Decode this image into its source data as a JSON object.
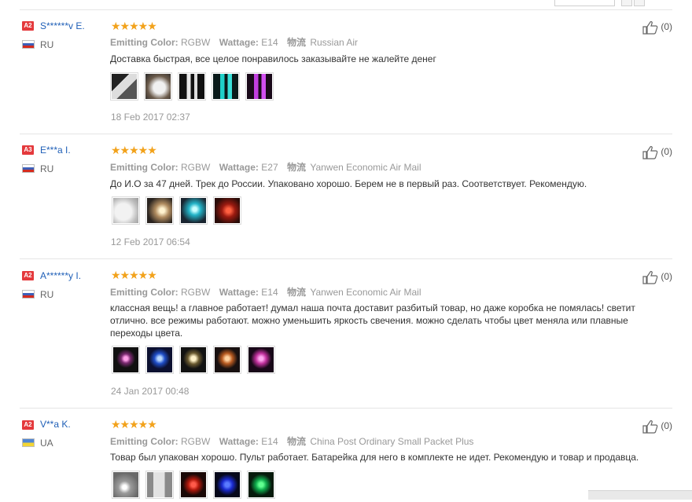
{
  "labels": {
    "color": "Emitting Color:",
    "wattage": "Wattage:",
    "shipping": "物流"
  },
  "stars": "★★★★★",
  "reviews": [
    {
      "badge": "A2",
      "name": "S******v E.",
      "country": "RU",
      "color": "RGBW",
      "wattage": "E14",
      "shipping": "Russian Air",
      "text": "Доставка быстрая, все целое понравилось заказывайте не жалейте денег",
      "date": "18 Feb 2017 02:37",
      "likes": "(0)"
    },
    {
      "badge": "A3",
      "name": "E***a I.",
      "country": "RU",
      "color": "RGBW",
      "wattage": "E27",
      "shipping": "Yanwen Economic Air Mail",
      "text": "До И.О за 47 дней. Трек до России. Упаковано хорошо. Берем не в первый раз. Соответствует. Рекомендую.",
      "date": "12 Feb 2017 06:54",
      "likes": "(0)"
    },
    {
      "badge": "A2",
      "name": "A******y I.",
      "country": "RU",
      "color": "RGBW",
      "wattage": "E14",
      "shipping": "Yanwen Economic Air Mail",
      "text": "классная вещь! а главное работает! думал наша почта доставит разбитый товар, но даже коробка не помялась! светит отлично. все режимы работают. можно уменьшить яркость свечения. можно сделать чтобы цвет меняла или плавные переходы цвета.",
      "date": "24 Jan 2017 00:48",
      "likes": "(0)"
    },
    {
      "badge": "A2",
      "name": "V**a K.",
      "country": "UA",
      "color": "RGBW",
      "wattage": "E14",
      "shipping": "China Post Ordinary Small Packet Plus",
      "text": "Товар был упакован хорошо. Пульт работает. Батарейка для него в комплекте не идет. Рекомендую и товар и продавца.",
      "likes": "(0)"
    }
  ],
  "colors": {
    "username": "#1f5fb7",
    "badge": "#e4393c",
    "stars": "#f2a21b"
  }
}
